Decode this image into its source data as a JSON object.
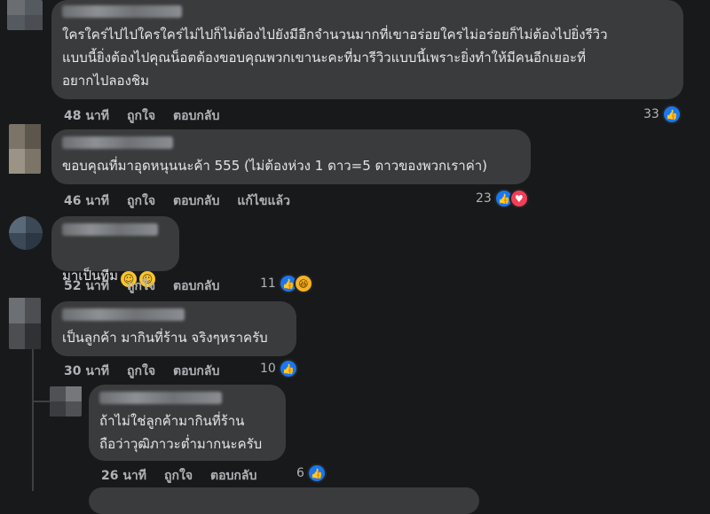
{
  "comments": [
    {
      "text": "ใครใคร่ไปไปใครใคร่ไม่ไปก็ไม่ต้องไปยังมีอีกจำนวนมากที่เขาอร่อยใครไม่อร่อยก็ไม่ต้องไปยิ่งรีวิว\nแบบนี้ยิ่งต้องไปคุณน็อตต้องขอบคุณพวกเขานะคะที่มารีวิวแบบนี้เพราะยิ่งทำให้มีคนอีกเยอะที่\nอยากไปลองชิม",
      "time": "48 นาที",
      "like_label": "ถูกใจ",
      "reply_label": "ตอบกลับ",
      "reaction_count": "33"
    },
    {
      "text": "ขอบคุณที่มาอุดหนุนนะค้า 555 (ไม่ต้องห่วง 1 ดาว=5 ดาวของพวกเราค่า)",
      "time": "46 นาที",
      "like_label": "ถูกใจ",
      "reply_label": "ตอบกลับ",
      "edited_label": "แก้ไขแล้ว",
      "reaction_count": "23"
    },
    {
      "text": "มาเป็นทีม",
      "emojis": [
        "☺",
        "☺"
      ],
      "time": "52 นาที",
      "like_label": "ถูกใจ",
      "reply_label": "ตอบกลับ",
      "reaction_count": "11"
    },
    {
      "text": "เป็นลูกค้า มากินที่ร้าน จริงๆหราครับ",
      "time": "30 นาที",
      "like_label": "ถูกใจ",
      "reply_label": "ตอบกลับ",
      "reaction_count": "10"
    },
    {
      "text": "ถ้าไม่ใช่ลูกค้ามากินที่ร้าน\nถือว่าวุฒิภาวะต่ำมากนะครับ",
      "time": "26 นาที",
      "like_label": "ถูกใจ",
      "reply_label": "ตอบกลับ",
      "reaction_count": "6"
    }
  ],
  "icons": {
    "like": "thumbs-up-icon",
    "love": "heart-icon",
    "haha": "laughing-face-icon"
  },
  "colors": {
    "background": "#18191a",
    "bubble": "#3a3b3c",
    "like": "#1877f2",
    "love": "#f33e58",
    "haha": "#f7b125"
  }
}
